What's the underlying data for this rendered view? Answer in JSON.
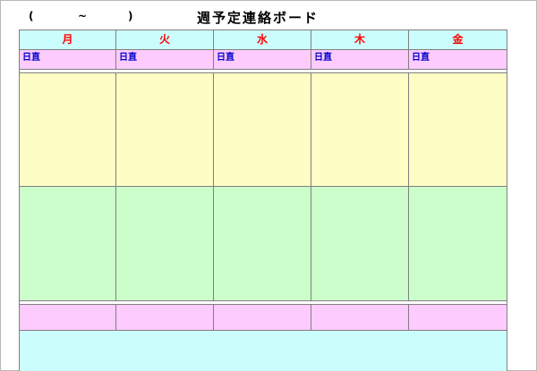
{
  "header": {
    "open_paren": "(",
    "tilde": "~",
    "close_paren": ")",
    "title": "週予定連絡ボード"
  },
  "days": [
    "月",
    "火",
    "水",
    "木",
    "金"
  ],
  "duty_label": "日直",
  "colors": {
    "day_header_bg": "#ccfdfd",
    "day_text": "#ff0000",
    "duty_bg": "#fecbfe",
    "duty_text": "#0000cc",
    "morning_bg": "#fefdc5",
    "afternoon_bg": "#ccfecb",
    "bottom_bg": "#ccfdfd"
  }
}
